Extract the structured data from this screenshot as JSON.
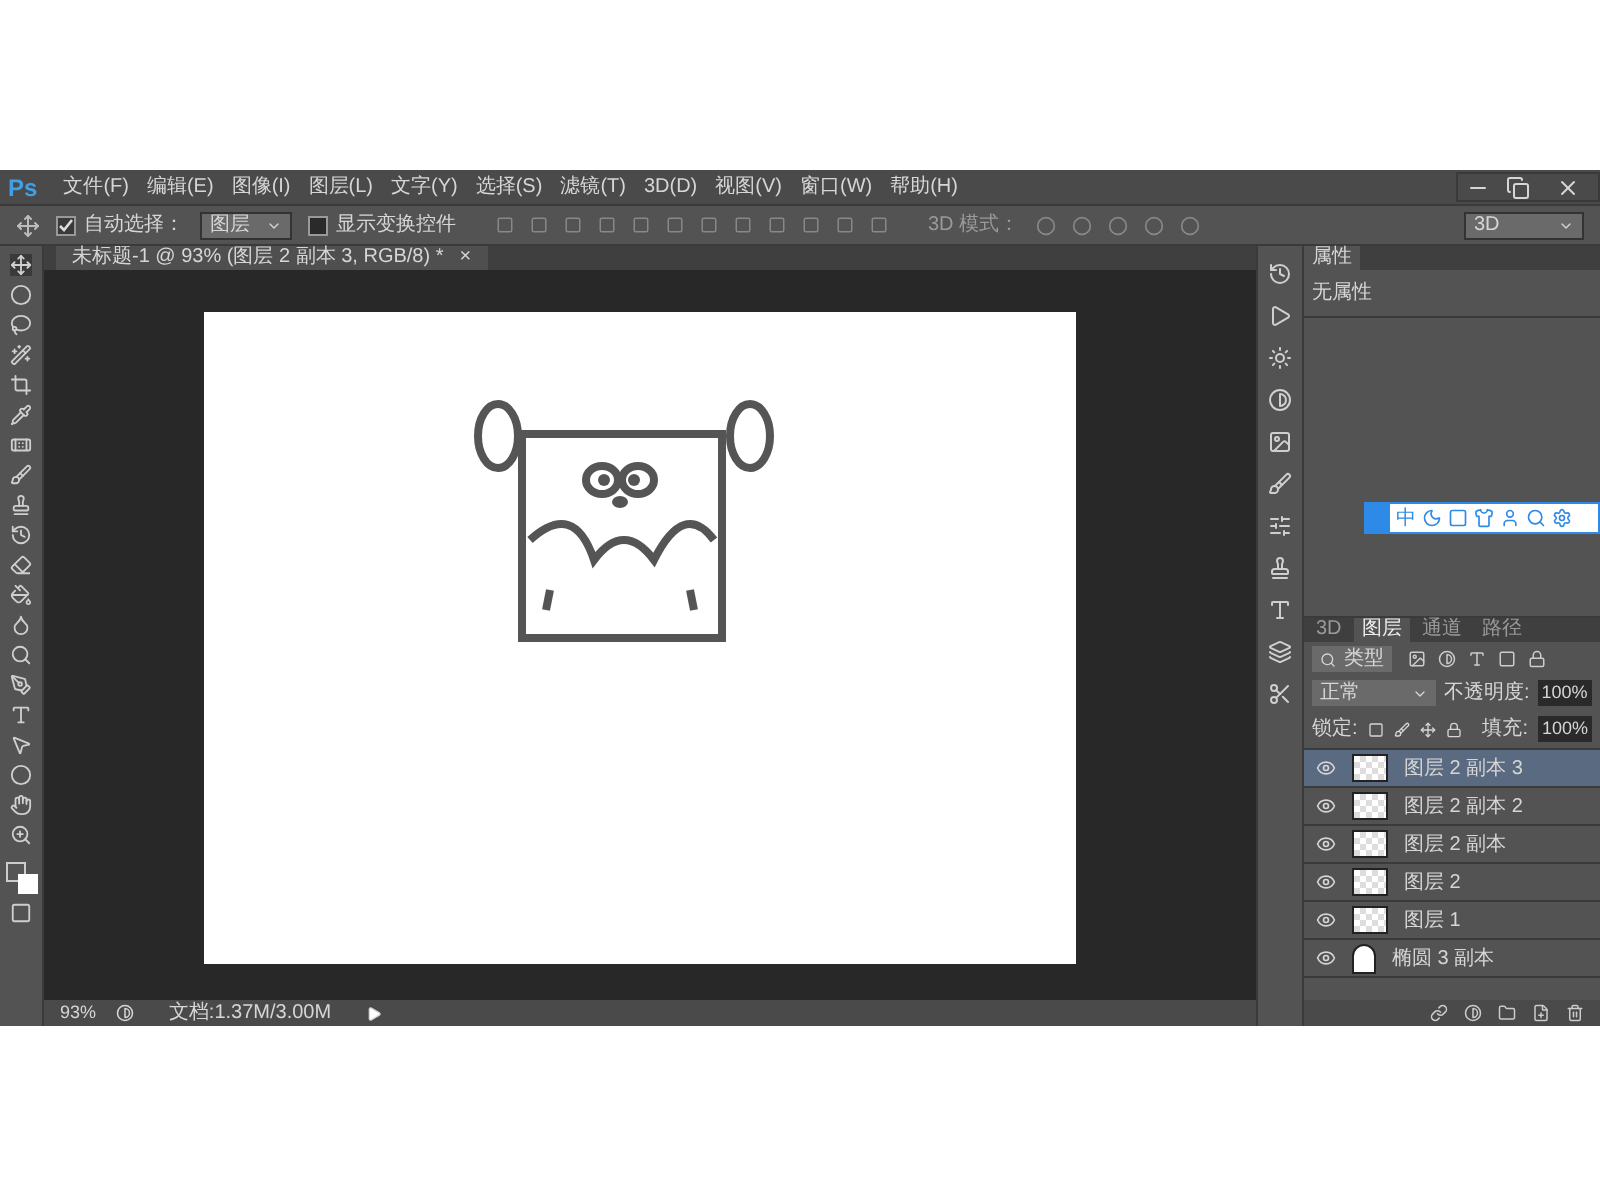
{
  "app": {
    "logo": "Ps"
  },
  "menu": [
    "文件(F)",
    "编辑(E)",
    "图像(I)",
    "图层(L)",
    "文字(Y)",
    "选择(S)",
    "滤镜(T)",
    "3D(D)",
    "视图(V)",
    "窗口(W)",
    "帮助(H)"
  ],
  "options_bar": {
    "auto_select": {
      "label": "自动选择：",
      "checked": true
    },
    "auto_select_target": "图层",
    "show_transform": {
      "label": "显示变换控件",
      "checked": false
    },
    "mode_3d_label": "3D 模式：",
    "workspace": "3D"
  },
  "document_tab": {
    "title": "未标题-1 @ 93% (图层 2 副本 3, RGB/8) *",
    "close": "×"
  },
  "properties_panel": {
    "tab": "属性",
    "text": "无属性"
  },
  "ime_toolbar": {
    "label": "中"
  },
  "layers_panel": {
    "tabs": [
      {
        "label": "3D",
        "selected": false
      },
      {
        "label": "图层",
        "selected": true
      },
      {
        "label": "通道",
        "selected": false
      },
      {
        "label": "路径",
        "selected": false
      }
    ],
    "filter": "类型",
    "blend_mode": "正常",
    "opacity_label": "不透明度:",
    "opacity": "100%",
    "lock_label": "锁定:",
    "fill_label": "填充:",
    "fill": "100%",
    "layers": [
      {
        "name": "图层 2 副本 3",
        "selected": true,
        "visible": true,
        "kind": "raster"
      },
      {
        "name": "图层 2 副本 2",
        "selected": false,
        "visible": true,
        "kind": "raster"
      },
      {
        "name": "图层 2 副本",
        "selected": false,
        "visible": true,
        "kind": "raster"
      },
      {
        "name": "图层 2",
        "selected": false,
        "visible": true,
        "kind": "raster"
      },
      {
        "name": "图层 1",
        "selected": false,
        "visible": true,
        "kind": "raster"
      },
      {
        "name": "椭圆 3 副本",
        "selected": false,
        "visible": true,
        "kind": "shape"
      }
    ]
  },
  "status_bar": {
    "zoom": "93%",
    "document": "文档:1.37M/3.00M"
  }
}
